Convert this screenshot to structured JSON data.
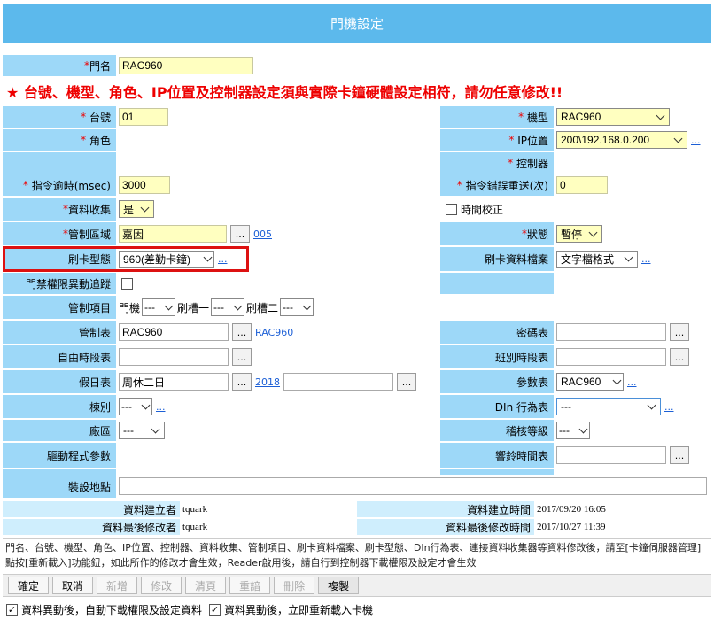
{
  "title": "門機設定",
  "warning": "★ 台號、機型、角色、IP位置及控制器設定須與實際卡鐘硬體設定相符，請勿任意修改!!",
  "door_name": {
    "label": "門名",
    "value": "RAC960"
  },
  "station_no": {
    "label": "台號",
    "value": "01"
  },
  "role": {
    "label": "角色"
  },
  "model": {
    "label": "機型",
    "value": "RAC960"
  },
  "ip": {
    "label": "IP位置",
    "value": "200\\192.168.0.200",
    "link": "..."
  },
  "controller": {
    "label": "控制器"
  },
  "cmd_timeout": {
    "label": "指令逾時(msec)",
    "value": "3000"
  },
  "cmd_retry": {
    "label": "指令錯誤重送(次)",
    "value": "0"
  },
  "data_collect": {
    "label": "資料收集",
    "value": "是"
  },
  "time_sync": {
    "label": "時間校正"
  },
  "control_area": {
    "label": "管制區域",
    "value": "嘉因",
    "dots": "...",
    "code": "005"
  },
  "status": {
    "label": "狀態",
    "value": "暫停"
  },
  "card_mode": {
    "label": "刷卡型態",
    "value": "960(差勤卡鐘)",
    "link": "..."
  },
  "card_file": {
    "label": "刷卡資料檔案",
    "value": "文字檔格式",
    "link": "..."
  },
  "access_track": {
    "label": "門禁權限異動追蹤"
  },
  "control_items": {
    "label": "管制項目",
    "door": "門機",
    "slot1": "刷槽一",
    "slot2": "刷槽二",
    "empty": "---"
  },
  "control_table": {
    "label": "管制表",
    "value": "RAC960",
    "dots": "...",
    "link": "RAC960"
  },
  "password_table": {
    "label": "密碼表",
    "dots": "..."
  },
  "free_period": {
    "label": "自由時段表",
    "dots": "..."
  },
  "shift_period": {
    "label": "班別時段表",
    "dots": "..."
  },
  "holiday": {
    "label": "假日表",
    "value": "周休二日",
    "dots": "...",
    "year": "2018"
  },
  "param_table": {
    "label": "參數表",
    "value": "RAC960",
    "link": "..."
  },
  "building": {
    "label": "棟別",
    "value": "---",
    "link": "..."
  },
  "din_table": {
    "label": "DIn 行為表",
    "value": "---",
    "link": "..."
  },
  "factory": {
    "label": "廠區",
    "value": "---"
  },
  "audit_level": {
    "label": "稽核等級",
    "value": "---"
  },
  "driver_params": {
    "label": "驅動程式參數"
  },
  "bell_table": {
    "label": "響鈴時間表",
    "dots": "..."
  },
  "install_location": {
    "label": "裝設地點"
  },
  "meta": {
    "created_by_label": "資料建立者",
    "created_by": "tquark",
    "created_time_label": "資料建立時間",
    "created_time": "2017/09/20 16:05",
    "modified_by_label": "資料最後修改者",
    "modified_by": "tquark",
    "modified_time_label": "資料最後修改時間",
    "modified_time": "2017/10/27 11:39"
  },
  "note": "門名、台號、機型、角色、IP位置、控制器、資料收集、管制項目、刷卡資料檔案、刷卡型態、DIn行為表、連接資料收集器等資料修改後，請至[卡鐘伺服器管理]點按[重新載入]功能鈕，如此所作的修改才會生效，Reader啟用後，請自行到控制器下載權限及設定才會生效",
  "toolbar": {
    "confirm": "確定",
    "cancel": "取消",
    "add": "新增",
    "edit": "修改",
    "clear": "清頁",
    "reset": "重諳",
    "delete": "刪除",
    "copy": "複製"
  },
  "footer": {
    "auto_download": "資料異動後，自動下載權限及設定資料",
    "auto_reload": "資料異動後，立即重新載入卡機"
  },
  "check_mark": "✓"
}
